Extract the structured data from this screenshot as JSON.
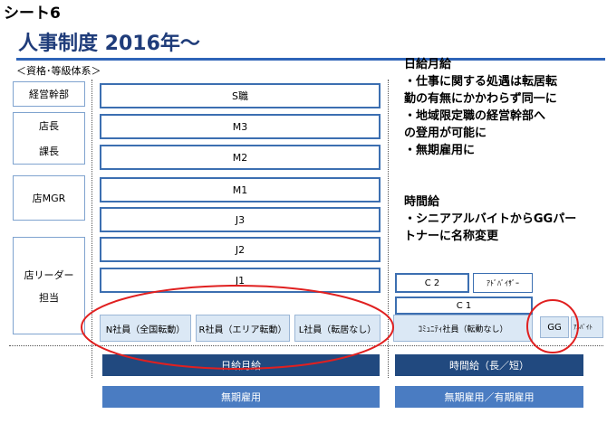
{
  "sheet_title": "シート6",
  "main_title": "人事制度 2016年～",
  "subheading": "＜資格･等級体系＞",
  "left_labels": {
    "executive": "経営幹部",
    "store_manager": "店長",
    "section_chief": "課長",
    "store_mgr": "店MGR",
    "store_leader": "店リーダー",
    "in_charge": "担当"
  },
  "grades_monthly": [
    "S職",
    "M3",
    "M2",
    "M1",
    "J3",
    "J2",
    "J1"
  ],
  "staff_monthly": [
    "N社員（全国転動）",
    "R社員（エリア転動）",
    "L社員（転居なし）"
  ],
  "hourly": {
    "c2": "C 2",
    "advisor": "ｱﾄﾞﾊﾞｲｻﾞｰ",
    "c1": "C 1",
    "community": "ｺﾐｭﾆﾃｨ社員（転動なし）",
    "gg": "GG",
    "arubaito": "ｱﾙﾊﾞｲﾄ"
  },
  "bars": {
    "monthly_pay": "日給月給",
    "hourly_pay": "時間給（長／短）",
    "monthly_term": "無期雇用",
    "hourly_term": "無期雇用／有期雇用"
  },
  "notes": {
    "monthly": {
      "title": "日給月給",
      "lines": [
        "・仕事に関する処遇は転居転",
        "勤の有無にかかわらず同一に",
        "・地域限定職の経営幹部へ",
        "の登用が可能に",
        "・無期雇用に"
      ]
    },
    "hourly": {
      "title": "時間給",
      "lines": [
        "・シニアアルバイトからGGパー",
        "トナーに名称変更"
      ]
    }
  },
  "colors": {
    "title": "#1f3c7a",
    "level_border": "#3c6fb1",
    "staff_fill": "#dbe8f5",
    "dark_bar": "#21497f",
    "light_bar": "#4a7cc2",
    "highlight_circle": "#e02020"
  }
}
